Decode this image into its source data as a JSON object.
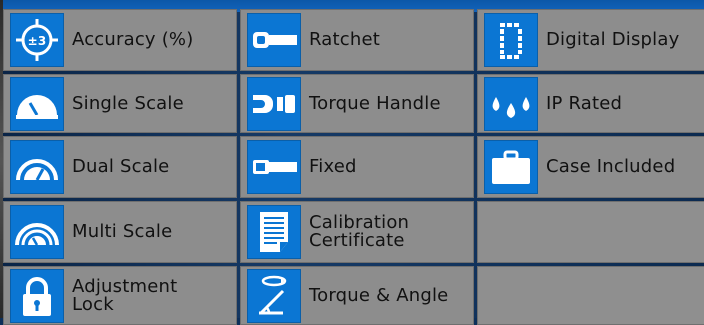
{
  "features": [
    {
      "label": "Accuracy (%)",
      "icon": "accuracy-icon",
      "icon_text": "±3"
    },
    {
      "label": "Ratchet",
      "icon": "ratchet-icon"
    },
    {
      "label": "Digital Display",
      "icon": "digital-display-icon"
    },
    {
      "label": "Single Scale",
      "icon": "single-scale-icon"
    },
    {
      "label": "Torque Handle",
      "icon": "torque-handle-icon"
    },
    {
      "label": "IP Rated",
      "icon": "ip-rated-icon"
    },
    {
      "label": "Dual Scale",
      "icon": "dual-scale-icon"
    },
    {
      "label": "Fixed",
      "icon": "fixed-icon"
    },
    {
      "label": "Case Included",
      "icon": "case-icon"
    },
    {
      "label": "Multi Scale",
      "icon": "multi-scale-icon"
    },
    {
      "label": "Calibration\nCertificate",
      "icon": "calibration-certificate-icon"
    },
    {
      "label": "",
      "icon": ""
    },
    {
      "label": "Adjustment\nLock",
      "icon": "adjustment-lock-icon"
    },
    {
      "label": "Torque & Angle",
      "icon": "torque-angle-icon"
    },
    {
      "label": "",
      "icon": ""
    }
  ],
  "colors": {
    "icon_bg": "#0b76d3",
    "cell_bg": "#8d8d8d",
    "accent": "#0c57a8"
  }
}
